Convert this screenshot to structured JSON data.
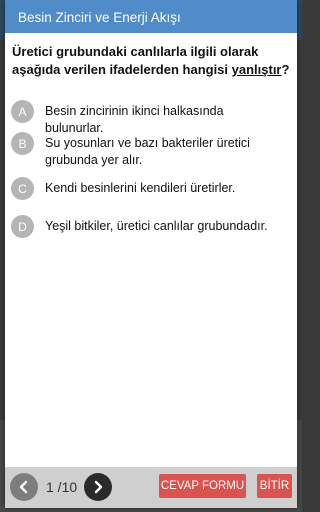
{
  "header": {
    "title": "Besin Zinciri ve Enerji Akışı"
  },
  "question": {
    "text_before": "Üretici grubundaki canlılarla ilgili olarak aşağıda verilen ifadelerden hangisi ",
    "text_underlined": "yanlıştır",
    "text_after": "?"
  },
  "options": [
    {
      "letter": "A",
      "text": "Besin zincirinin ikinci halkasında bulunurlar."
    },
    {
      "letter": "B",
      "text": "Su yosunları ve bazı bakteriler üretici grubunda yer alır."
    },
    {
      "letter": "C",
      "text": "Kendi besinlerini kendileri üretirler."
    },
    {
      "letter": "D",
      "text": "Yeşil bitkiler, üretici canlılar grubundadır."
    }
  ],
  "footer": {
    "page_indicator": "1 /10",
    "prev_icon": "chevron-left-icon",
    "next_icon": "chevron-right-icon",
    "answer_form_label": "CEVAP FORMU",
    "finish_label": "BİTİR"
  },
  "colors": {
    "header": "#4f8cc9",
    "letter_circle": "#b5b5b5",
    "action_button": "#d9534f",
    "footer": "#cfcfcf"
  }
}
